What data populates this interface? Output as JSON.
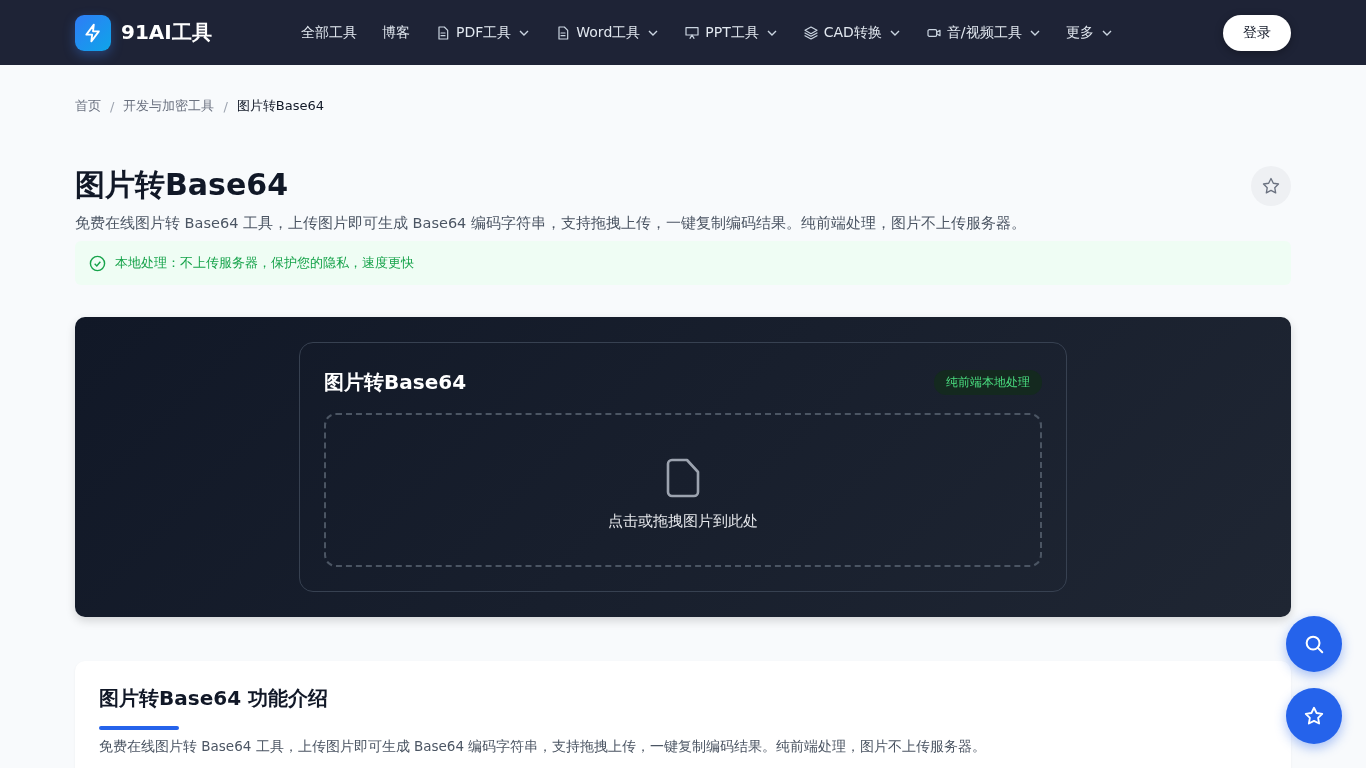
{
  "header": {
    "logo_text": "91AI工具",
    "nav": [
      {
        "label": "全部工具",
        "kind": "link"
      },
      {
        "label": "博客",
        "kind": "link"
      },
      {
        "label": "PDF工具",
        "kind": "dropdown"
      },
      {
        "label": "Word工具",
        "kind": "dropdown"
      },
      {
        "label": "PPT工具",
        "kind": "dropdown"
      },
      {
        "label": "CAD转换",
        "kind": "dropdown"
      },
      {
        "label": "音/视频工具",
        "kind": "dropdown"
      },
      {
        "label": "更多",
        "kind": "dropdown"
      }
    ],
    "login": "登录"
  },
  "breadcrumb": [
    "首页",
    "开发与加密工具",
    "图片转Base64"
  ],
  "breadcrumb_separator": "/",
  "title": "图片转Base64",
  "description": "免费在线图片转 Base64 工具，上传图片即可生成 Base64 编码字符串，支持拖拽上传，一键复制编码结果。纯前端处理，图片不上传服务器。",
  "notice": "本地处理：不上传服务器，保护您的隐私，速度更快",
  "tool": {
    "title": "图片转Base64",
    "badge": "纯前端本地处理",
    "dropzone": "点击或拖拽图片到此处"
  },
  "intro": {
    "heading": "图片转Base64 功能介绍",
    "text": "免费在线图片转 Base64 工具，上传图片即可生成 Base64 编码字符串，支持拖拽上传，一键复制编码结果。纯前端处理，图片不上传服务器。"
  }
}
